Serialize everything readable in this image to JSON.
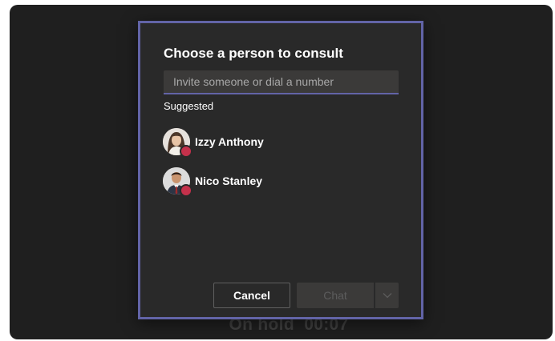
{
  "status": {
    "on_hold_label": "On hold",
    "timer": "00:07"
  },
  "dialog": {
    "title": "Choose a person to consult",
    "search": {
      "placeholder": "Invite someone or dial a number",
      "value": ""
    },
    "section_label": "Suggested",
    "people": [
      {
        "name": "Izzy Anthony",
        "presence": "busy",
        "presence_color": "#c4314b"
      },
      {
        "name": "Nico Stanley",
        "presence": "busy",
        "presence_color": "#c4314b"
      }
    ],
    "buttons": {
      "cancel": "Cancel",
      "chat": "Chat",
      "chat_dropdown_icon": "chevron-down-icon"
    }
  },
  "colors": {
    "accent": "#6264a7",
    "window_bg": "#1f1f1f",
    "dialog_bg": "#292929",
    "presence_busy": "#c4314b"
  }
}
